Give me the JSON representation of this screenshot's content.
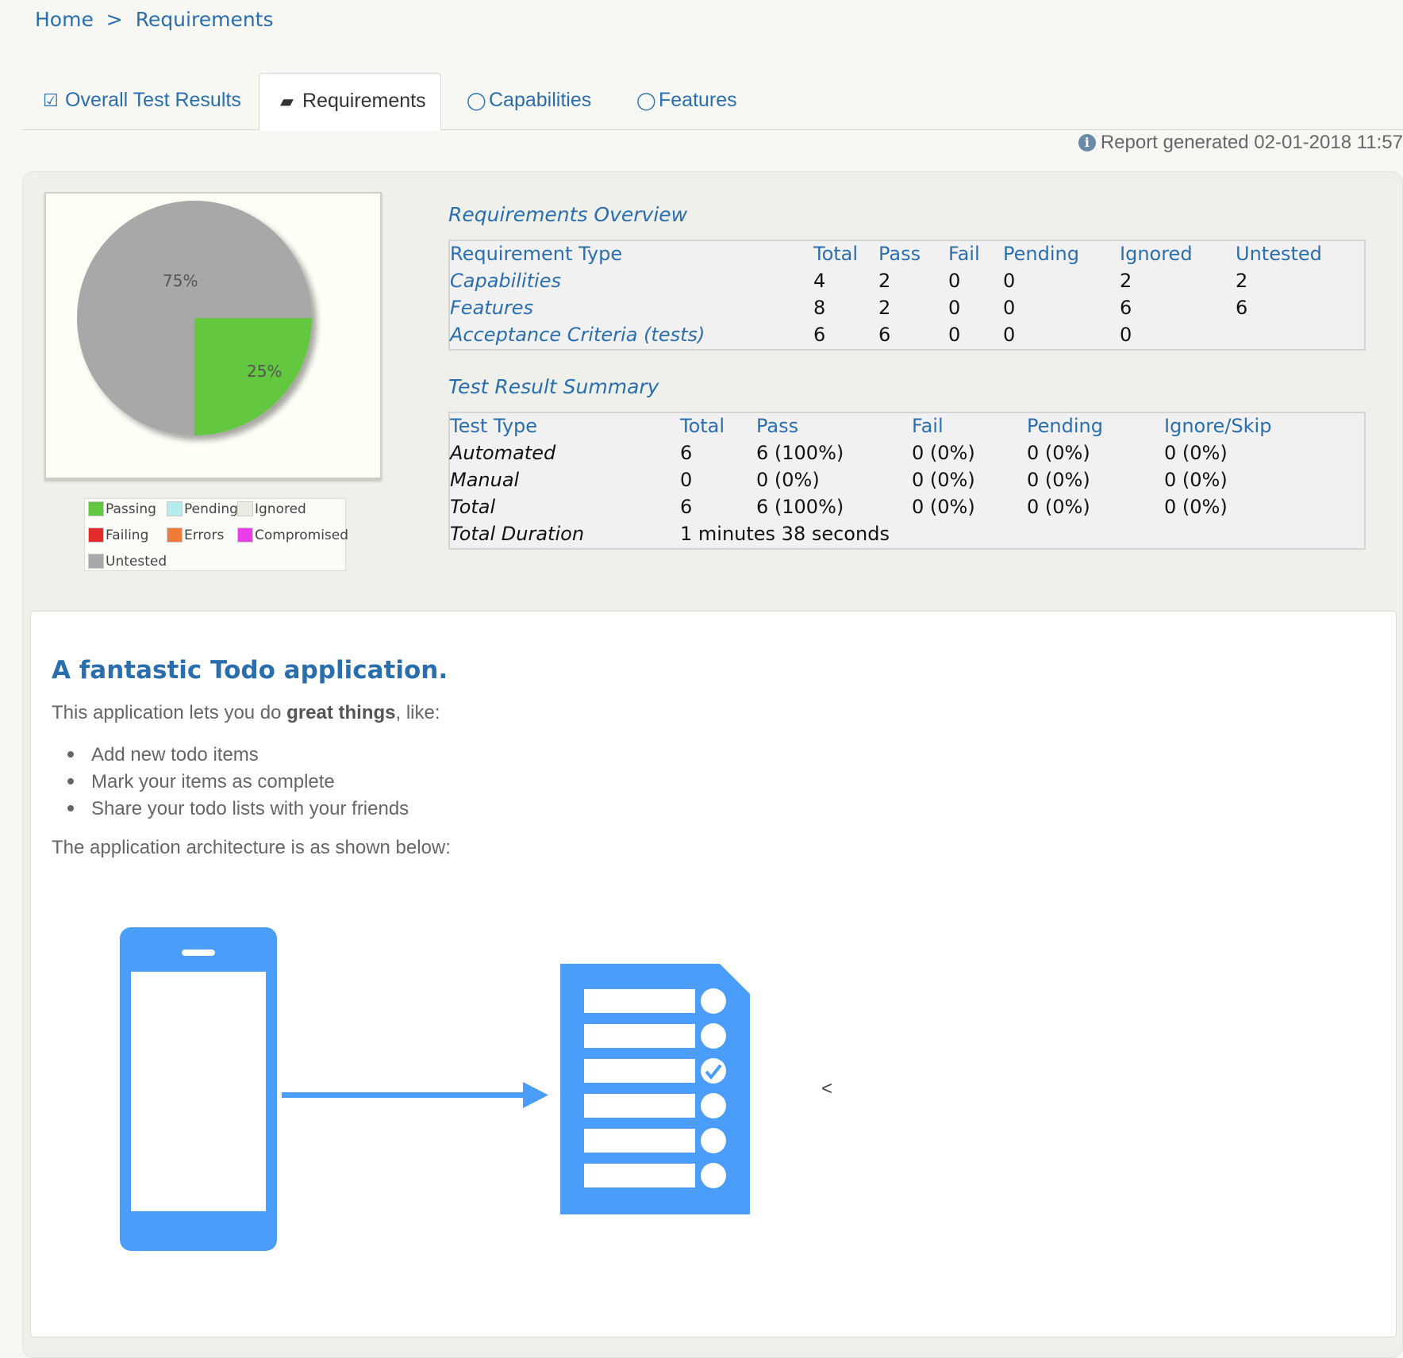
{
  "breadcrumb": {
    "home": "Home",
    "separator": ">",
    "current": "Requirements"
  },
  "tabs": [
    {
      "label": "Overall Test Results",
      "icon": "check-square-icon",
      "active": false
    },
    {
      "label": "Requirements",
      "icon": "book-icon",
      "active": true
    },
    {
      "label": "Capabilities",
      "icon": "comments-icon",
      "active": false
    },
    {
      "label": "Features",
      "icon": "comments-icon",
      "active": false
    }
  ],
  "report_generated": "Report generated 02-01-2018 11:57",
  "pie": {
    "labels": [
      "75%",
      "25%"
    ],
    "slices": [
      {
        "name": "Untested",
        "percent": 75,
        "color": "#a8a8a8"
      },
      {
        "name": "Passing",
        "percent": 25,
        "color": "#63c841"
      }
    ]
  },
  "legend": [
    {
      "label": "Passing",
      "color": "#63c841"
    },
    {
      "label": "Pending",
      "color": "#b5ecee"
    },
    {
      "label": "Ignored",
      "color": "#ebebe2"
    },
    {
      "label": "Failing",
      "color": "#e32b2b"
    },
    {
      "label": "Errors",
      "color": "#ee7b3a"
    },
    {
      "label": "Compromised",
      "color": "#e83de8"
    },
    {
      "label": "Untested",
      "color": "#a8a8a8"
    }
  ],
  "requirements_overview": {
    "title": "Requirements Overview",
    "headers": [
      "Requirement Type",
      "Total",
      "Pass",
      "Fail",
      "Pending",
      "Ignored",
      "Untested"
    ],
    "rows": [
      {
        "type": "Capabilities",
        "total": "4",
        "pass": "2",
        "fail": "0",
        "pending": "0",
        "ignored": "2",
        "untested": "2"
      },
      {
        "type": "Features",
        "total": "8",
        "pass": "2",
        "fail": "0",
        "pending": "0",
        "ignored": "6",
        "untested": "6"
      },
      {
        "type": "Acceptance Criteria (tests)",
        "total": "6",
        "pass": "6",
        "fail": "0",
        "pending": "0",
        "ignored": "0",
        "untested": ""
      }
    ]
  },
  "test_result_summary": {
    "title": "Test Result Summary",
    "headers": [
      "Test Type",
      "Total",
      "Pass",
      "Fail",
      "Pending",
      "Ignore/Skip"
    ],
    "rows": [
      {
        "type": "Automated",
        "total": "6",
        "pass": "6 (100%)",
        "fail": "0 (0%)",
        "pending": "0 (0%)",
        "ignore": "0 (0%)"
      },
      {
        "type": "Manual",
        "total": "0",
        "pass": "0 (0%)",
        "fail": "0 (0%)",
        "pending": "0 (0%)",
        "ignore": "0 (0%)"
      },
      {
        "type": "Total",
        "total": "6",
        "pass": "6 (100%)",
        "fail": "0 (0%)",
        "pending": "0 (0%)",
        "ignore": "0 (0%)"
      }
    ],
    "duration_label": "Total Duration",
    "duration_value": "1 minutes 38 seconds"
  },
  "narrative": {
    "title": "A fantastic Todo application.",
    "intro_before": "This application lets you do ",
    "intro_bold": "great things",
    "intro_after": ", like:",
    "items": [
      "Add new todo items",
      "Mark your items as complete",
      "Share your todo lists with your friends"
    ],
    "architecture_text": "The application architecture is as shown below:",
    "trailing_mark": "<"
  },
  "colors": {
    "accent": "#2a6eae",
    "diagram_blue": "#4a9df8"
  }
}
